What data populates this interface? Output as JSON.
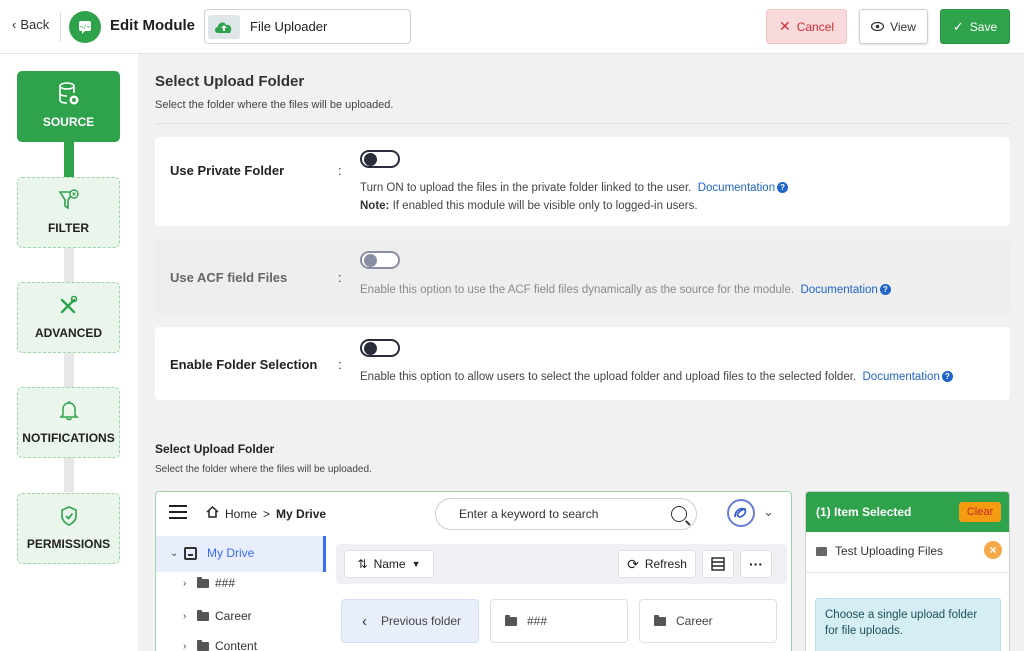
{
  "header": {
    "back_label": "Back",
    "edit_title": "Edit Module",
    "module_name": "File Uploader",
    "cancel_label": "Cancel",
    "view_label": "View",
    "save_label": "Save"
  },
  "steps": [
    {
      "label": "SOURCE",
      "icon": "database-icon",
      "active": true
    },
    {
      "label": "FILTER",
      "icon": "filter-icon",
      "active": false
    },
    {
      "label": "ADVANCED",
      "icon": "tools-icon",
      "active": false
    },
    {
      "label": "NOTIFICATIONS",
      "icon": "bell-icon",
      "active": false
    },
    {
      "label": "PERMISSIONS",
      "icon": "shield-icon",
      "active": false
    }
  ],
  "section": {
    "title": "Select Upload Folder",
    "subtitle": "Select the folder where the files will be uploaded."
  },
  "options": [
    {
      "label": "Use Private Folder",
      "enabled": false,
      "description": "Turn ON to upload the files in the private folder linked to the user.",
      "doc_label": "Documentation",
      "note_prefix": "Note:",
      "note": "If enabled this module will be visible only to logged-in users."
    },
    {
      "label": "Use ACF field Files",
      "enabled": false,
      "disabled": true,
      "description": "Enable this option to use the ACF field files dynamically as the source for the module.",
      "doc_label": "Documentation"
    },
    {
      "label": "Enable Folder Selection",
      "enabled": false,
      "description": "Enable this option to allow users to select the upload folder and upload files to the selected folder.",
      "doc_label": "Documentation"
    }
  ],
  "section2": {
    "title": "Select Upload Folder",
    "subtitle": "Select the folder where the files will be uploaded."
  },
  "browser": {
    "crumb_home": "Home",
    "crumb_separator": ">",
    "crumb_current": "My Drive",
    "search_placeholder": "Enter a keyword to search",
    "tree": [
      {
        "label": "My Drive",
        "selected": true
      },
      {
        "label": "###"
      },
      {
        "label": "Career"
      },
      {
        "label": "Content"
      }
    ],
    "sort_label": "Name",
    "refresh_label": "Refresh",
    "tiles": [
      {
        "label": "Previous folder",
        "type": "back"
      },
      {
        "label": "###",
        "type": "folder"
      },
      {
        "label": "Career",
        "type": "folder"
      }
    ]
  },
  "selected_panel": {
    "title": "(1) Item Selected",
    "clear_label": "Clear",
    "item": "Test Uploading Files",
    "info": "Choose a single upload folder for file uploads."
  },
  "colors": {
    "accent_green": "#2fa24c",
    "link_blue": "#1e64c8",
    "cancel_red": "#d32f2f"
  }
}
